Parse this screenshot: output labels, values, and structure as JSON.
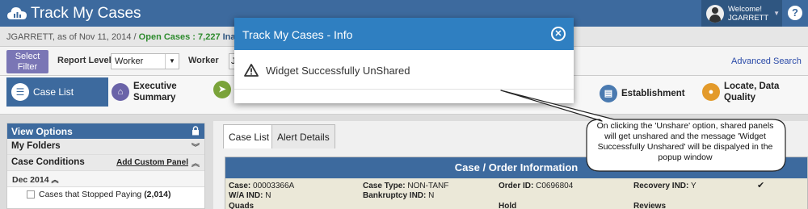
{
  "app": {
    "title": "Track My Cases"
  },
  "user": {
    "greeting": "Welcome!",
    "name": "JGARRETT"
  },
  "status_line": {
    "prefix": "JGARRETT, as of Nov 11, 2014",
    "separator": "/",
    "open_cases": "Open Cases : 7,227",
    "inactive": "Inactiv"
  },
  "filter": {
    "select_filter": "Select Filter",
    "report_level_label": "Report Level",
    "report_level_value": "Worker",
    "worker_label": "Worker",
    "worker_value": "J",
    "advanced_search": "Advanced Search"
  },
  "nav_tabs": {
    "case_list": "Case List",
    "executive_summary": "Executive Summary",
    "establishment": "Establishment",
    "locate_data_quality": "Locate, Data Quality"
  },
  "left_panel": {
    "title": "View Options",
    "my_folders": "My Folders",
    "case_conditions": "Case Conditions",
    "add_custom_panel": "Add Custom Panel",
    "group": "Dec 2014",
    "item_label": "Cases that Stopped Paying",
    "item_count": "(2,014)"
  },
  "main_tabs": {
    "case_list": "Case List",
    "alert_details": "Alert Details"
  },
  "case_panel": {
    "title": "Case / Order Information",
    "case_label": "Case:",
    "case_value": "00003366A",
    "case_type_label": "Case Type:",
    "case_type_value": "NON-TANF",
    "order_id_label": "Order ID:",
    "order_id_value": "C0696804",
    "recovery_label": "Recovery IND:",
    "recovery_value": "Y",
    "wa_label": "W/A IND:",
    "wa_value": "N",
    "bankruptcy_label": "Bankruptcy IND:",
    "bankruptcy_value": "N",
    "row3_a": "Quads",
    "row3_b": "Hold",
    "row3_c": "Reviews"
  },
  "modal": {
    "title": "Track My Cases - Info",
    "message": "Widget Successfully UnShared"
  },
  "callout": {
    "text": "On clicking the 'Unshare' option, shared panels will get unshared and the message 'Widget Successfully Unshared' will be dispalyed in the popup window"
  },
  "colors": {
    "header": "#3d6a9e",
    "modal_header": "#2f7fc1",
    "accent_purple": "#7a76b5"
  }
}
